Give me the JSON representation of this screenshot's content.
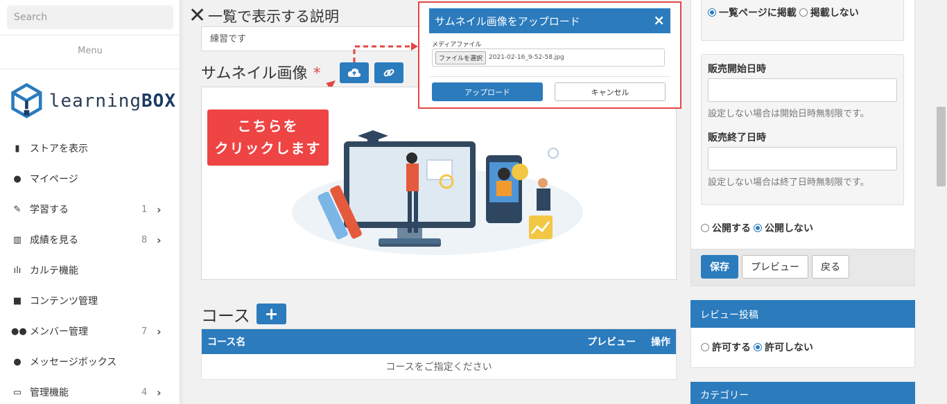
{
  "sidebar": {
    "search_placeholder": "Search",
    "menu_label": "Menu",
    "logo": {
      "part1": "learning",
      "part2": "BOX"
    },
    "items": [
      {
        "label": "ストアを表示",
        "count": "",
        "chevron": false,
        "icon": "book-icon"
      },
      {
        "label": "マイページ",
        "count": "",
        "chevron": false,
        "icon": "user-icon"
      },
      {
        "label": "学習する",
        "count": "1",
        "chevron": true,
        "icon": "pencil-icon"
      },
      {
        "label": "成績を見る",
        "count": "8",
        "chevron": true,
        "icon": "bar-chart-icon"
      },
      {
        "label": "カルテ機能",
        "count": "",
        "chevron": false,
        "icon": "chart-icon"
      },
      {
        "label": "コンテンツ管理",
        "count": "",
        "chevron": false,
        "icon": "folder-icon"
      },
      {
        "label": "メンバー管理",
        "count": "7",
        "chevron": true,
        "icon": "users-icon"
      },
      {
        "label": "メッセージボックス",
        "count": "",
        "chevron": false,
        "icon": "comments-icon"
      },
      {
        "label": "管理機能",
        "count": "4",
        "chevron": true,
        "icon": "desktop-icon"
      }
    ]
  },
  "main": {
    "description_title": "一覧で表示する説明",
    "description_value": "練習です",
    "thumbnail_title": "サムネイル画像",
    "required_mark": "*",
    "callout_line1": "こちらを",
    "callout_line2": "クリックします",
    "course_title": "コース",
    "course_add": "+",
    "course_table": {
      "col_name": "コース名",
      "col_preview": "プレビュー",
      "col_ops": "操作",
      "empty": "コースをご指定ください"
    }
  },
  "dialog": {
    "title": "サムネイル画像をアップロード",
    "close": "×",
    "media_label": "メディアファイル",
    "file_button": "ファイルを選択",
    "file_name": "2021-02-16_9-52-58.jpg",
    "upload": "アップロード",
    "cancel": "キャンセル"
  },
  "right": {
    "listing": {
      "opt1": "一覧ページに掲載",
      "opt2": "掲載しない"
    },
    "sale_start_label": "販売開始日時",
    "sale_start_help": "設定しない場合は開始日時無制限です。",
    "sale_end_label": "販売終了日時",
    "sale_end_help": "設定しない場合は終了日時無制限です。",
    "publish": {
      "opt1": "公開する",
      "opt2": "公開しない"
    },
    "save": "保存",
    "preview": "プレビュー",
    "back": "戻る",
    "review_header": "レビュー投稿",
    "review": {
      "opt1": "許可する",
      "opt2": "許可しない"
    },
    "category_header": "カテゴリー"
  },
  "colors": {
    "accent": "#2b7bbd",
    "callout": "#ee4444",
    "highlight_border": "#e54545"
  }
}
